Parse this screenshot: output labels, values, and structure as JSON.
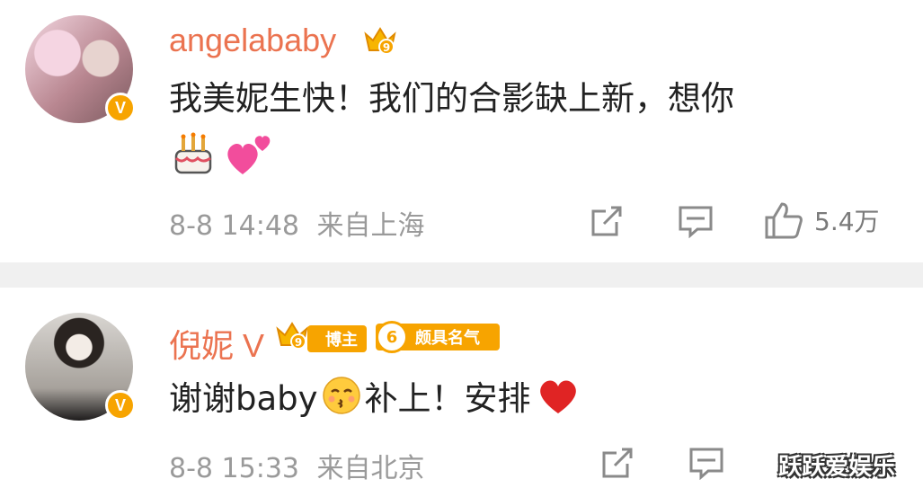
{
  "posts": [
    {
      "username": "angelababy",
      "membership_level": "9",
      "content_line1": "我美妮生快！我们的合影缺上新，想你",
      "emojis": [
        "birthday-cake",
        "two-hearts"
      ],
      "timestamp": "8-8 14:48",
      "location": "来自上海",
      "like_count": "5.4万",
      "verified_badge": "V"
    },
    {
      "username": "倪妮 V",
      "membership_level": "9",
      "tags": {
        "blogger": "博主",
        "popular_level": "6",
        "popular": "颇具名气"
      },
      "content_prefix": "谢谢baby",
      "content_suffix": "补上！安排",
      "emojis": [
        "kissing-face",
        "red-heart"
      ],
      "timestamp": "8-8 15:33",
      "location": "来自北京",
      "verified_badge": "V"
    }
  ],
  "watermark": "跃跃爱娱乐",
  "colors": {
    "username": "#eb7350",
    "badge": "#f7a400",
    "meta": "#9a9a9a",
    "divider": "#f0f0f0"
  }
}
